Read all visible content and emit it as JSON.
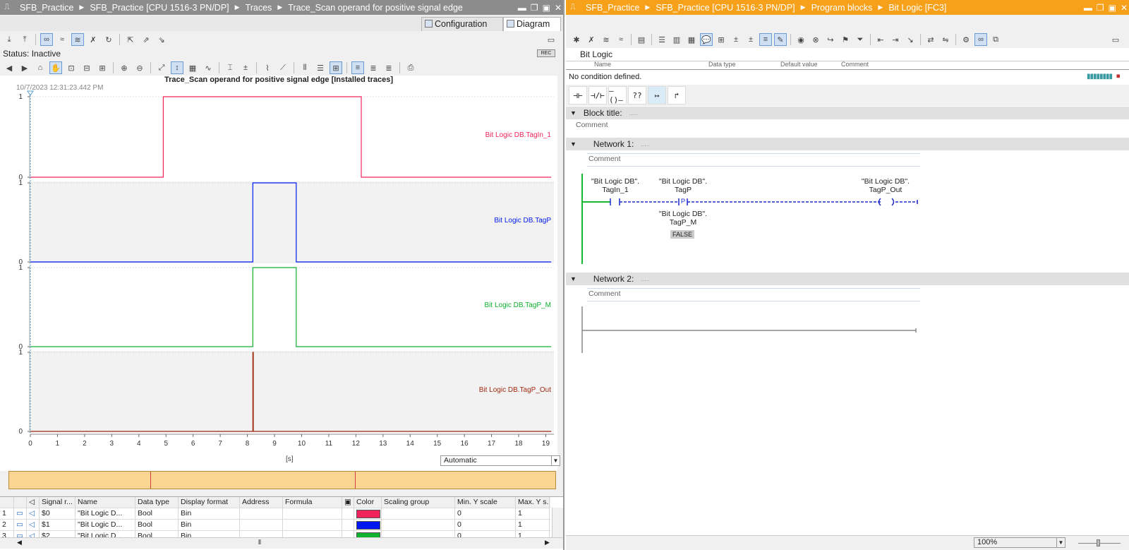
{
  "left": {
    "breadcrumb": [
      "SFB_Practice",
      "SFB_Practice [CPU 1516-3 PN/DP]",
      "Traces",
      "Trace_Scan operand for positive signal edge"
    ],
    "tabs": [
      "Configuration",
      "Diagram"
    ],
    "status": "Status: Inactive",
    "rec_label": "REC",
    "diagram_title": "Trace_Scan operand for positive signal edge [Installed traces]",
    "timestamp": "10/7/2023  12:31:23.442 PM",
    "x_unit": "[s]",
    "scale_mode": "Automatic",
    "grid": {
      "headers": [
        "Signal r...",
        "Name",
        "Data type",
        "Display format",
        "Address",
        "Formula",
        "Color",
        "Scaling group",
        "Min. Y scale",
        "Max. Y s..."
      ],
      "rows": [
        {
          "num": "1",
          "signal": "$0",
          "name": "\"Bit Logic D...",
          "type": "Bool",
          "format": "Bin",
          "color": "#f0245a",
          "min": "0",
          "max": "1"
        },
        {
          "num": "2",
          "signal": "$1",
          "name": "\"Bit Logic D...",
          "type": "Bool",
          "format": "Bin",
          "color": "#0018f0",
          "min": "0",
          "max": "1"
        },
        {
          "num": "3",
          "signal": "$2",
          "name": "\"Bit Logic D...",
          "type": "Bool",
          "format": "Bin",
          "color": "#10b030",
          "min": "0",
          "max": "1"
        }
      ]
    }
  },
  "chart_data": {
    "type": "line",
    "x_ticks": [
      0,
      1,
      2,
      3,
      4,
      5,
      6,
      7,
      8,
      9,
      10,
      11,
      12,
      13,
      14,
      15,
      16,
      17,
      18,
      19
    ],
    "xlim": [
      0,
      19.3
    ],
    "xlabel": "[s]",
    "ylim": [
      0,
      1
    ],
    "y_ticks": [
      0,
      1
    ],
    "series": [
      {
        "name": "Bit Logic DB.TagIn_1",
        "color": "#f0245a",
        "points": [
          [
            0,
            0
          ],
          [
            4.9,
            0
          ],
          [
            4.9,
            1
          ],
          [
            12.2,
            1
          ],
          [
            12.2,
            0
          ],
          [
            19.2,
            0
          ]
        ]
      },
      {
        "name": "Bit Logic DB.TagP",
        "color": "#0018f0",
        "points": [
          [
            0,
            0
          ],
          [
            8.2,
            0
          ],
          [
            8.2,
            1
          ],
          [
            9.8,
            1
          ],
          [
            9.8,
            0
          ],
          [
            19.2,
            0
          ]
        ]
      },
      {
        "name": "Bit Logic DB.TagP_M",
        "color": "#10b030",
        "points": [
          [
            0,
            0
          ],
          [
            8.2,
            0
          ],
          [
            8.2,
            1
          ],
          [
            9.8,
            1
          ],
          [
            9.8,
            0
          ],
          [
            19.2,
            0
          ]
        ]
      },
      {
        "name": "Bit Logic DB.TagP_Out",
        "color": "#a02a10",
        "points": [
          [
            0,
            0
          ],
          [
            8.2,
            0
          ],
          [
            8.2,
            1
          ],
          [
            8.22,
            1
          ],
          [
            8.22,
            0
          ],
          [
            19.2,
            0
          ]
        ]
      }
    ]
  },
  "right": {
    "breadcrumb": [
      "SFB_Practice",
      "SFB_Practice [CPU 1516-3 PN/DP]",
      "Program blocks",
      "Bit Logic [FC3]"
    ],
    "block_name": "Bit Logic",
    "col_headers": [
      "Name",
      "Data type",
      "Default value",
      "Comment"
    ],
    "condition": "No condition defined.",
    "ladder_tools": [
      "⊣⊢",
      "⊣/⊢",
      "–()–",
      "??",
      "↦",
      "↱"
    ],
    "block_title_label": "Block title:",
    "block_title_dots": ".....",
    "comment_label": "Comment",
    "network1": {
      "label": "Network 1:",
      "dots": ".....",
      "comment": "Comment",
      "contact_db": "\"Bit Logic DB\".",
      "contact_tag": "TagIn_1",
      "pcontact_db": "\"Bit Logic DB\".",
      "pcontact_tag": "TagP",
      "pcontact_symbol": "P",
      "mem_db": "\"Bit Logic DB\".",
      "mem_tag": "TagP_M",
      "mem_value": "FALSE",
      "coil_db": "\"Bit Logic DB\".",
      "coil_tag": "TagP_Out"
    },
    "network2": {
      "label": "Network 2:",
      "dots": ".....",
      "comment": "Comment"
    },
    "zoom": "100%"
  }
}
